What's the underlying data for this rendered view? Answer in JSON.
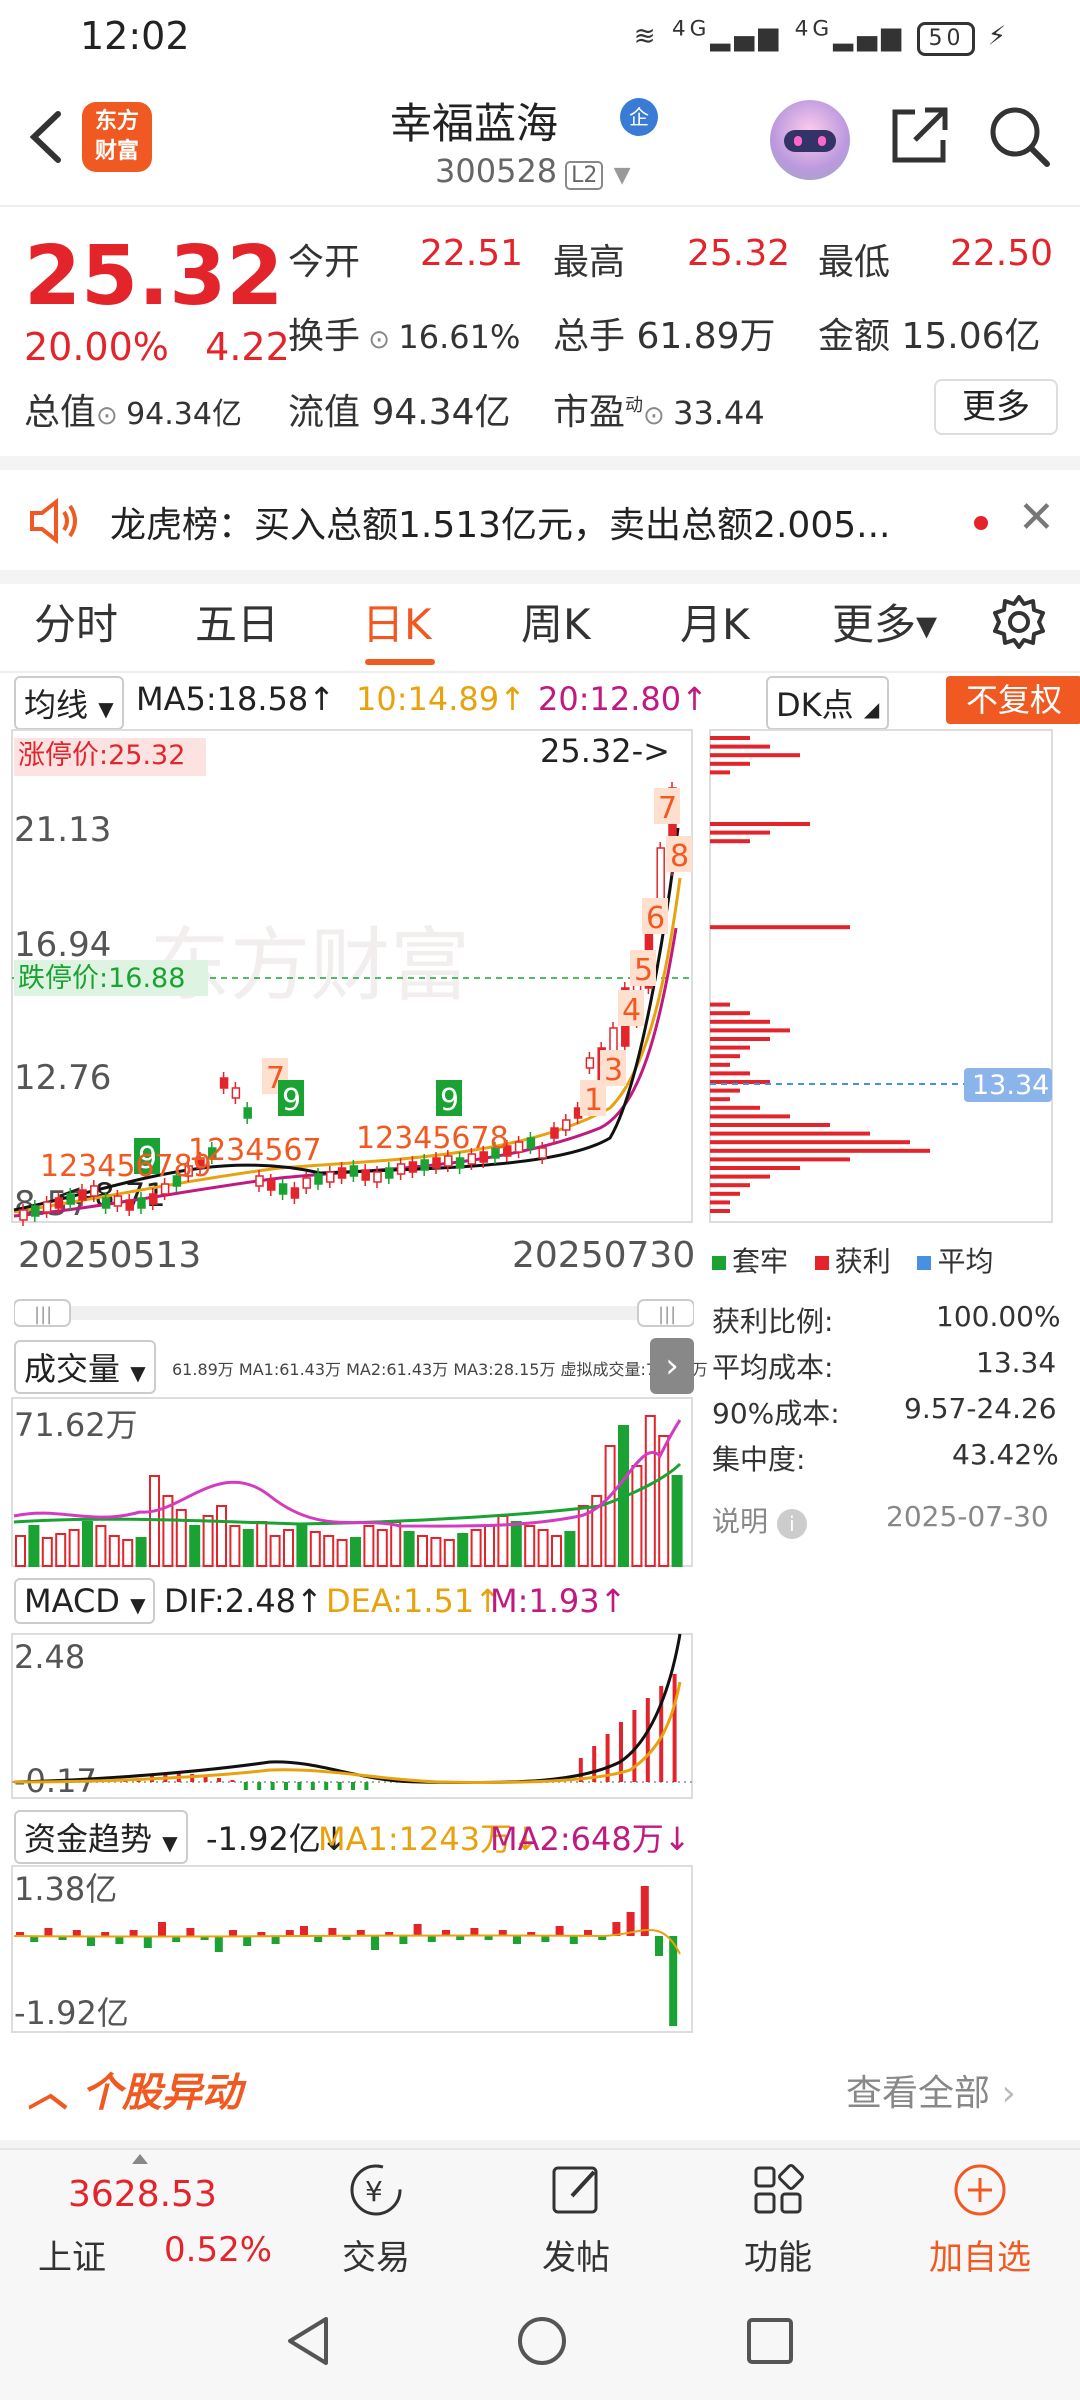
{
  "status_bar": {
    "time": "12:02",
    "signal1": "4G",
    "signal2": "4G",
    "battery": "50"
  },
  "header": {
    "back_icon": "chevron-left-icon",
    "app_logo": "东方财富",
    "stock_name": "幸福蓝海",
    "stock_tag": "企",
    "stock_code": "300528",
    "level_badge": "L2"
  },
  "quote": {
    "price": "25.32",
    "change_pct": "20.00%",
    "change_amt": "4.22",
    "open_label": "今开",
    "open": "22.51",
    "high_label": "最高",
    "high": "25.32",
    "low_label": "最低",
    "low": "22.50",
    "turnover_label": "换手",
    "turnover": "16.61%",
    "volume_label": "总手",
    "volume": "61.89万",
    "amount_label": "金额",
    "amount": "15.06亿",
    "mktcap_label": "总值",
    "mktcap": "94.34亿",
    "float_label": "流值",
    "float": "94.34亿",
    "pe_label": "市盈",
    "pe_super": "动",
    "pe": "33.44",
    "more_label": "更多"
  },
  "notice": {
    "text": "龙虎榜：买入总额1.513亿元，卖出总额2.005..."
  },
  "tabs": [
    "分时",
    "五日",
    "日K",
    "周K",
    "月K",
    "更多▾"
  ],
  "active_tab": "日K",
  "chart_toolbar": {
    "ma_select": "均线",
    "ma5": "MA5:18.58↑",
    "ma10": "10:14.89↑",
    "ma20": "20:12.80↑",
    "dk_select": "DK点",
    "adj_button": "不复权"
  },
  "chart_labels": {
    "limit_up": "涨停价:25.32",
    "limit_down": "跌停价:16.88",
    "y_top": "21.13",
    "y_mid": "16.94",
    "y_low": "12.76",
    "y_bottom": "8.57",
    "high_marker": "25.32->",
    "low_marker": "<-8.71",
    "date_start": "20250513",
    "date_end": "20250730",
    "chip_avg": "13.34",
    "watermark": "东方财富"
  },
  "chip_panel": {
    "legend": [
      "套牢",
      "获利",
      "平均"
    ],
    "rows": [
      {
        "label": "获利比例:",
        "value": "100.00%"
      },
      {
        "label": "平均成本:",
        "value": "13.34"
      },
      {
        "label": "90%成本:",
        "value": "9.57-24.26"
      },
      {
        "label": "集中度:",
        "value": "43.42%"
      }
    ],
    "note_label": "说明",
    "date": "2025-07-30"
  },
  "volume": {
    "select": "成交量",
    "line": "61.89万 MA1:61.43万 MA2:61.43万 MA3:28.15万 虚拟成交量:70.64万",
    "y_top": "71.62万"
  },
  "macd": {
    "select": "MACD",
    "dif": "DIF:2.48↑",
    "dea": "DEA:1.51↑",
    "m": "M:1.93↑",
    "y_top": "2.48",
    "y_bottom": "-0.17"
  },
  "fund": {
    "select": "资金趋势",
    "val": "-1.92亿↓",
    "ma1": "MA1:1243万↓",
    "ma2": "MA2:648万↓",
    "y_top": "1.38亿",
    "y_bottom": "-1.92亿"
  },
  "section": {
    "title": "个股异动",
    "view_all": "查看全部"
  },
  "bottom_nav": {
    "index_value": "3628.53",
    "index_name": "上证",
    "index_change": "0.52%",
    "items": [
      "交易",
      "发帖",
      "功能",
      "加自选"
    ]
  },
  "colors": {
    "red": "#e3242b",
    "green": "#1aa333",
    "orange": "#f05a22",
    "blue": "#4a90e2"
  }
}
